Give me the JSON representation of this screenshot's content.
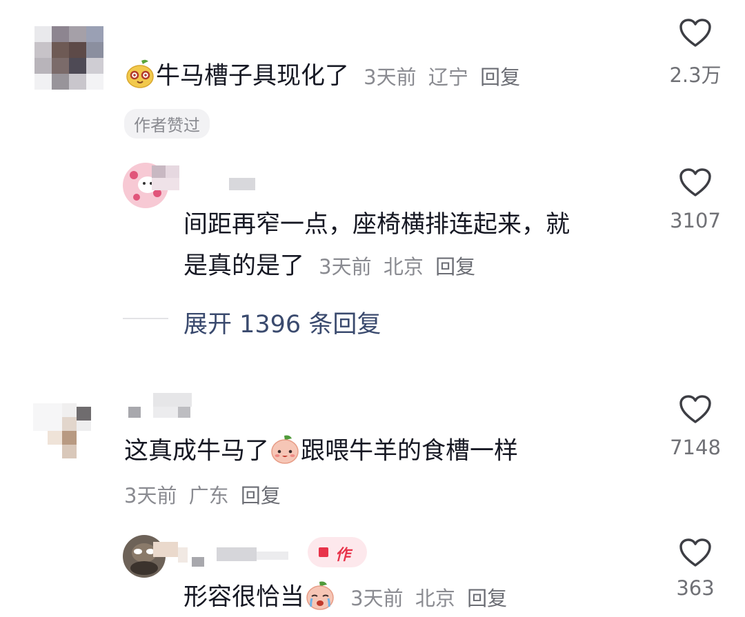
{
  "comments": [
    {
      "text": "牛马槽子具现化了",
      "emoji": "pear-face-emoji",
      "time": "3天前",
      "location": "辽宁",
      "reply_label": "回复",
      "badge": "作者赞过",
      "likes": "2.3万",
      "replies": [
        {
          "text_line1": "间距再窄一点，座椅横排连起来，就",
          "text_line2": "是真的是了",
          "time": "3天前",
          "location": "北京",
          "reply_label": "回复",
          "likes": "3107"
        }
      ],
      "expand_label": "展开 1396 条回复"
    },
    {
      "text_a": "这真成牛马了",
      "emoji": "peach-face-emoji",
      "text_b": "跟喂牛羊的食槽一样",
      "time": "3天前",
      "location": "广东",
      "reply_label": "回复",
      "likes": "7148",
      "replies": [
        {
          "text": "形容很恰当",
          "emoji": "crying-peach-emoji",
          "time": "3天前",
          "location": "北京",
          "reply_label": "回复",
          "likes": "363",
          "author_badge_text": "作"
        }
      ]
    }
  ],
  "colors": {
    "text": "#161823",
    "meta": "#8a8b91",
    "expand": "#3a4a6e",
    "author_badge": "#e8334a"
  }
}
